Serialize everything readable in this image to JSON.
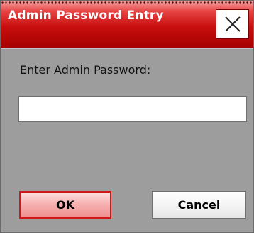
{
  "window": {
    "title": "Admin Password Entry",
    "close_icon": "close-x-icon"
  },
  "form": {
    "prompt_label": "Enter Admin Password:",
    "password_value": "",
    "password_placeholder": ""
  },
  "buttons": {
    "ok_label": "OK",
    "cancel_label": "Cancel"
  },
  "colors": {
    "titlebar_accent": "#c90f0f",
    "dialog_background": "#9d9d9d",
    "ok_border": "#d01818",
    "ok_fill": "#f7b2b2"
  }
}
